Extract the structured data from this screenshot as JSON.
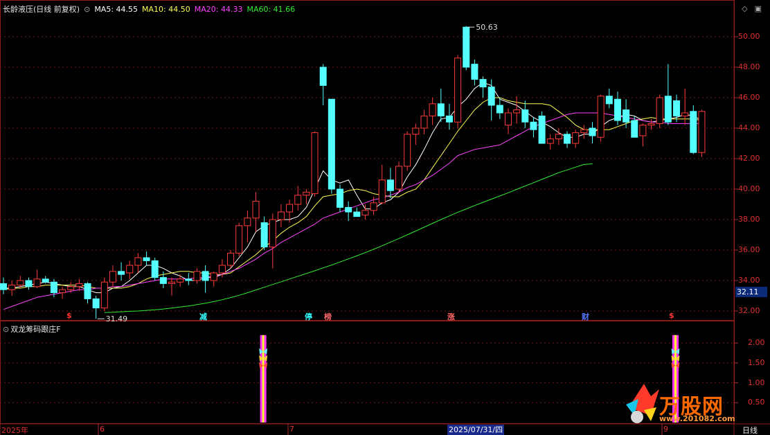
{
  "header": {
    "title": "长龄液压(日线 前复权)",
    "dropdown_glyph": "⊙",
    "ma": [
      {
        "label": "MA5: 44.55",
        "color": "#ffffff"
      },
      {
        "label": "MA10: 44.50",
        "color": "#ffff55"
      },
      {
        "label": "MA20: 44.33",
        "color": "#ff44ff"
      },
      {
        "label": "MA60: 41.66",
        "color": "#33ee33"
      }
    ],
    "controls": {
      "diamond": "◇",
      "settings": "▣"
    }
  },
  "indicator_panel": {
    "title": "双龙筹码跟庄F",
    "dropdown_glyph": "⊙",
    "y_ticks": [
      "2.00",
      "1.50",
      "1.00",
      "0.50"
    ],
    "y_values": [
      2.0,
      1.5,
      1.0,
      0.5
    ]
  },
  "chart_data": [
    {
      "type": "candlestick",
      "title": "长龄液压(日线 前复权)",
      "ylim": [
        31.5,
        51.5
      ],
      "y_ticks": [
        "50.00",
        "48.00",
        "46.00",
        "44.00",
        "42.00",
        "40.00",
        "38.00",
        "36.00",
        "34.00",
        "32.00"
      ],
      "y_tick_values": [
        50,
        48,
        46,
        44,
        42,
        40,
        38,
        36,
        34,
        32
      ],
      "x_labels": [
        "2025年",
        "6",
        "7",
        "9"
      ],
      "highlight_date": "2025/07/31/四",
      "current_price": "32.11",
      "period": "日线",
      "annotations": [
        {
          "text": "50.63",
          "value": 50.63,
          "kind": "high"
        },
        {
          "text": "31.49",
          "value": 31.49,
          "kind": "low"
        }
      ],
      "markers": [
        {
          "text": "$",
          "color": "#ff3333"
        },
        {
          "text": "减",
          "color": "#33ffff"
        },
        {
          "text": "停",
          "color": "#33ffff"
        },
        {
          "text": "榜",
          "color": "#ff6666"
        },
        {
          "text": "涨",
          "color": "#ff6666"
        },
        {
          "text": "财",
          "color": "#5577ff"
        },
        {
          "text": "$",
          "color": "#ff3333"
        }
      ],
      "candles": [
        [
          33.8,
          34.2,
          33.1,
          33.4
        ],
        [
          33.4,
          34.0,
          33.0,
          33.7
        ],
        [
          33.7,
          34.3,
          33.5,
          34.0
        ],
        [
          34.0,
          34.2,
          33.4,
          33.6
        ],
        [
          33.6,
          34.7,
          33.5,
          34.1
        ],
        [
          34.1,
          34.3,
          33.8,
          33.9
        ],
        [
          33.9,
          34.1,
          32.9,
          33.2
        ],
        [
          33.2,
          33.6,
          32.8,
          33.4
        ],
        [
          33.4,
          33.9,
          33.2,
          33.6
        ],
        [
          33.6,
          34.1,
          33.3,
          33.8
        ],
        [
          33.8,
          33.9,
          32.5,
          32.8
        ],
        [
          32.8,
          33.0,
          31.49,
          32.2
        ],
        [
          32.2,
          34.2,
          32.0,
          33.9
        ],
        [
          33.9,
          35.0,
          33.6,
          34.6
        ],
        [
          34.6,
          35.2,
          34.0,
          34.4
        ],
        [
          34.5,
          35.3,
          34.1,
          35.0
        ],
        [
          35.0,
          35.8,
          34.5,
          35.5
        ],
        [
          35.5,
          35.9,
          35.0,
          35.3
        ],
        [
          35.3,
          35.5,
          34.0,
          34.2
        ],
        [
          34.2,
          34.6,
          33.5,
          33.8
        ],
        [
          33.8,
          34.2,
          33.0,
          33.9
        ],
        [
          33.9,
          34.4,
          33.6,
          34.1
        ],
        [
          34.1,
          34.5,
          33.7,
          34.0
        ],
        [
          34.0,
          34.8,
          33.8,
          34.6
        ],
        [
          34.6,
          35.0,
          33.2,
          34.0
        ],
        [
          34.0,
          34.6,
          33.6,
          34.5
        ],
        [
          34.5,
          35.4,
          34.2,
          35.0
        ],
        [
          35.0,
          36.0,
          34.8,
          35.8
        ],
        [
          35.8,
          37.8,
          35.6,
          37.6
        ],
        [
          37.6,
          38.6,
          36.5,
          38.1
        ],
        [
          38.1,
          39.8,
          37.2,
          39.2
        ],
        [
          37.8,
          38.2,
          36.0,
          36.2
        ],
        [
          36.2,
          38.4,
          34.8,
          38.0
        ],
        [
          38.0,
          39.0,
          37.5,
          38.5
        ],
        [
          38.5,
          39.3,
          37.8,
          39.0
        ],
        [
          39.0,
          40.2,
          38.6,
          39.6
        ],
        [
          39.6,
          40.0,
          39.0,
          39.8
        ],
        [
          39.7,
          43.8,
          39.5,
          43.7
        ],
        [
          48.0,
          48.2,
          45.5,
          46.8
        ],
        [
          45.9,
          45.9,
          39.7,
          40.0
        ],
        [
          40.0,
          40.3,
          38.5,
          38.8
        ],
        [
          38.8,
          39.2,
          37.9,
          38.5
        ],
        [
          38.5,
          38.8,
          38.3,
          38.2
        ],
        [
          38.3,
          39.0,
          38.0,
          38.6
        ],
        [
          38.6,
          39.5,
          38.3,
          39.1
        ],
        [
          39.1,
          41.6,
          39.0,
          40.6
        ],
        [
          40.6,
          41.4,
          39.4,
          39.9
        ],
        [
          40.0,
          41.8,
          39.8,
          41.5
        ],
        [
          41.5,
          43.8,
          41.2,
          43.6
        ],
        [
          43.6,
          44.3,
          42.9,
          44.0
        ],
        [
          44.0,
          45.2,
          43.6,
          44.8
        ],
        [
          44.8,
          46.0,
          44.2,
          45.6
        ],
        [
          45.6,
          46.6,
          44.4,
          44.8
        ],
        [
          44.8,
          45.6,
          43.9,
          44.4
        ],
        [
          44.4,
          48.8,
          44.0,
          48.6
        ],
        [
          50.63,
          50.7,
          47.8,
          48.0
        ],
        [
          48.2,
          48.5,
          46.8,
          47.2
        ],
        [
          47.2,
          47.4,
          46.0,
          46.7
        ],
        [
          46.7,
          47.2,
          44.5,
          45.5
        ],
        [
          45.5,
          46.0,
          44.6,
          45.0
        ],
        [
          44.2,
          45.3,
          43.6,
          45.0
        ],
        [
          45.0,
          46.1,
          44.3,
          45.2
        ],
        [
          45.2,
          45.8,
          44.0,
          44.4
        ],
        [
          44.4,
          44.7,
          43.4,
          43.9
        ],
        [
          44.8,
          45.1,
          43.0,
          43.0
        ],
        [
          43.0,
          43.6,
          42.6,
          43.3
        ],
        [
          43.3,
          44.0,
          42.9,
          43.6
        ],
        [
          43.6,
          43.8,
          42.7,
          43.0
        ],
        [
          43.0,
          43.9,
          42.7,
          43.7
        ],
        [
          43.7,
          44.2,
          43.3,
          43.9
        ],
        [
          44.0,
          44.4,
          43.0,
          43.5
        ],
        [
          43.4,
          46.2,
          43.1,
          46.1
        ],
        [
          46.1,
          46.6,
          45.3,
          45.6
        ],
        [
          45.9,
          46.4,
          44.2,
          44.5
        ],
        [
          45.2,
          45.9,
          44.0,
          44.4
        ],
        [
          44.5,
          44.8,
          43.4,
          43.4
        ],
        [
          43.5,
          44.3,
          42.8,
          44.2
        ],
        [
          44.2,
          44.6,
          43.9,
          44.3
        ],
        [
          44.3,
          46.2,
          44.0,
          46.0
        ],
        [
          46.1,
          48.2,
          44.2,
          44.4
        ],
        [
          45.8,
          46.2,
          44.4,
          44.8
        ],
        [
          44.8,
          46.6,
          44.2,
          45.0
        ],
        [
          45.1,
          45.5,
          42.3,
          42.4
        ],
        [
          42.4,
          45.2,
          42.1,
          45.1
        ]
      ],
      "series": [
        {
          "name": "MA5",
          "color": "#ffffff",
          "values": [
            33.5,
            33.5,
            33.6,
            33.7,
            33.8,
            33.9,
            33.8,
            33.7,
            33.6,
            33.6,
            33.4,
            33.2,
            33.2,
            33.5,
            33.6,
            34.0,
            34.5,
            35.0,
            35.0,
            34.8,
            34.5,
            34.3,
            34.0,
            34.0,
            34.2,
            34.2,
            34.4,
            34.8,
            35.5,
            36.2,
            37.2,
            37.6,
            37.8,
            38.0,
            38.0,
            38.2,
            38.8,
            40.0,
            41.2,
            40.6,
            40.4,
            40.6,
            39.6,
            38.7,
            38.7,
            39.1,
            39.3,
            39.8,
            40.8,
            41.6,
            42.6,
            43.7,
            44.6,
            44.7,
            45.4,
            45.9,
            46.6,
            47.0,
            46.8,
            45.9,
            45.7,
            45.5,
            45.1,
            44.7,
            44.4,
            44.1,
            43.7,
            43.4,
            43.4,
            43.6,
            43.6,
            44.1,
            44.5,
            44.7,
            44.9,
            44.8,
            44.5,
            44.4,
            44.5,
            44.6,
            44.7,
            44.9,
            44.8,
            44.5
          ]
        },
        {
          "name": "MA10",
          "color": "#ffff55",
          "values": [
            33.4,
            33.5,
            33.5,
            33.6,
            33.6,
            33.7,
            33.7,
            33.7,
            33.7,
            33.7,
            33.6,
            33.5,
            33.5,
            33.5,
            33.5,
            33.6,
            33.8,
            34.1,
            34.3,
            34.4,
            34.5,
            34.6,
            34.6,
            34.5,
            34.5,
            34.4,
            34.4,
            34.5,
            34.9,
            35.3,
            35.7,
            36.2,
            36.6,
            37.1,
            37.5,
            37.8,
            38.2,
            38.9,
            39.5,
            39.6,
            39.7,
            39.9,
            40.0,
            39.9,
            39.7,
            39.6,
            39.5,
            39.5,
            39.8,
            40.0,
            40.6,
            41.4,
            42.2,
            43.0,
            43.8,
            44.5,
            45.2,
            45.7,
            46.0,
            46.0,
            45.8,
            45.7,
            45.6,
            45.6,
            45.6,
            45.5,
            45.1,
            44.7,
            44.2,
            43.9,
            43.9,
            43.9,
            43.9,
            44.1,
            44.3,
            44.5,
            44.6,
            44.7,
            44.6,
            44.6,
            44.6,
            44.6,
            44.6,
            44.5
          ]
        },
        {
          "name": "MA20",
          "color": "#ff44ff",
          "values": [
            32.1,
            32.3,
            32.5,
            32.7,
            32.9,
            33.0,
            33.1,
            33.2,
            33.3,
            33.4,
            33.4,
            33.5,
            33.5,
            33.6,
            33.6,
            33.7,
            33.8,
            33.9,
            34.0,
            34.1,
            34.1,
            34.1,
            34.1,
            34.2,
            34.2,
            34.3,
            34.4,
            34.6,
            34.8,
            35.1,
            35.4,
            35.8,
            36.1,
            36.5,
            36.8,
            37.1,
            37.4,
            37.7,
            38.1,
            38.3,
            38.5,
            38.7,
            38.9,
            39.1,
            39.3,
            39.4,
            39.6,
            39.8,
            40.1,
            40.3,
            40.6,
            40.9,
            41.3,
            41.7,
            42.2,
            42.4,
            42.6,
            42.7,
            42.8,
            42.9,
            43.2,
            43.5,
            43.8,
            44.1,
            44.3,
            44.5,
            44.7,
            44.9,
            45.0,
            45.0,
            45.0,
            45.0,
            44.9,
            44.8,
            44.7,
            44.6,
            44.5,
            44.4,
            44.4,
            44.3,
            44.3,
            44.3,
            44.3,
            44.3
          ]
        },
        {
          "name": "MA60",
          "color": "#33ee33",
          "values": [
            null,
            null,
            null,
            null,
            null,
            null,
            null,
            null,
            null,
            null,
            null,
            null,
            31.9,
            31.92,
            31.95,
            31.98,
            32.0,
            32.04,
            32.08,
            32.13,
            32.19,
            32.26,
            32.33,
            32.42,
            32.51,
            32.62,
            32.74,
            32.88,
            33.03,
            33.2,
            33.38,
            33.56,
            33.74,
            33.92,
            34.1,
            34.28,
            34.46,
            34.64,
            34.83,
            35.02,
            35.22,
            35.42,
            35.62,
            35.83,
            36.05,
            36.28,
            36.52,
            36.76,
            37.0,
            37.25,
            37.5,
            37.75,
            38.0,
            38.24,
            38.48,
            38.7,
            38.92,
            39.13,
            39.34,
            39.55,
            39.76,
            39.98,
            40.2,
            40.42,
            40.64,
            40.86,
            41.08,
            41.26,
            41.44,
            41.62,
            41.66
          ]
        }
      ]
    },
    {
      "type": "bar",
      "title": "双龙筹码跟庄F",
      "ylim": [
        0,
        2.3
      ],
      "signals": [
        {
          "candle_index": 31,
          "value": 2.2
        },
        {
          "candle_index": 80,
          "value": 2.2
        }
      ]
    }
  ]
}
